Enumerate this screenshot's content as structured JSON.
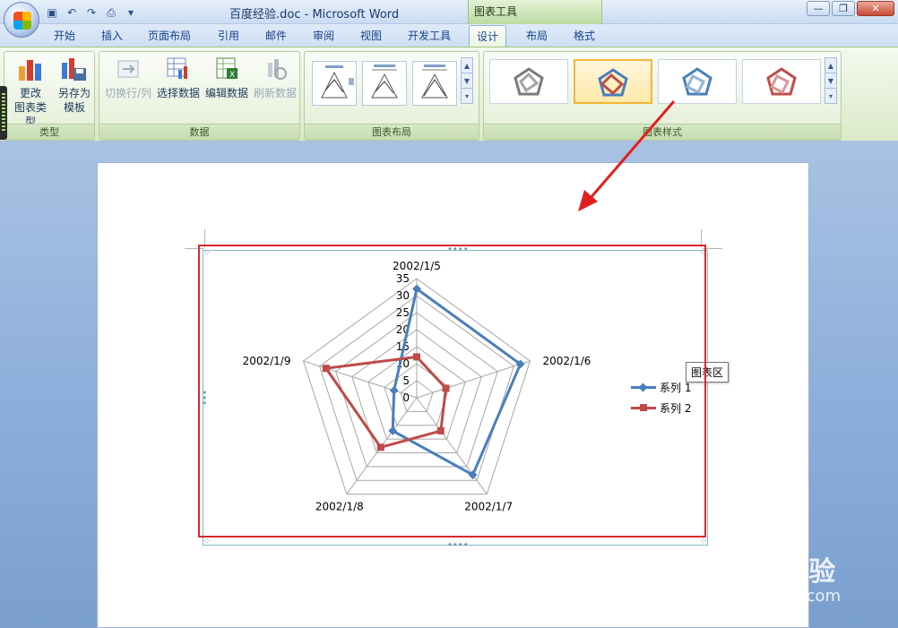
{
  "window": {
    "doc_title": "百度经验.doc - Microsoft Word",
    "context_tab_label": "图表工具"
  },
  "quick_access": [
    "save-icon",
    "undo-icon",
    "redo-icon",
    "print-preview-icon"
  ],
  "tabs": [
    "开始",
    "插入",
    "页面布局",
    "引用",
    "邮件",
    "审阅",
    "视图",
    "开发工具",
    "设计",
    "布局",
    "格式"
  ],
  "active_tab": "设计",
  "ribbon": {
    "groups": {
      "type": {
        "label": "类型",
        "buttons": [
          {
            "label1": "更改",
            "label2": "图表类型"
          },
          {
            "label1": "另存为",
            "label2": "模板"
          }
        ]
      },
      "data": {
        "label": "数据",
        "buttons": [
          {
            "label": "切换行/列",
            "disabled": true
          },
          {
            "label": "选择数据",
            "disabled": false
          },
          {
            "label": "编辑数据",
            "disabled": false
          },
          {
            "label": "刷新数据",
            "disabled": true
          }
        ]
      },
      "layout": {
        "label": "图表布局"
      },
      "styles": {
        "label": "图表样式"
      }
    }
  },
  "chart_tooltip": "图表区",
  "chart_data": {
    "type": "radar",
    "categories": [
      "2002/1/5",
      "2002/1/6",
      "2002/1/7",
      "2002/1/8",
      "2002/1/9"
    ],
    "series": [
      {
        "name": "系列 1",
        "values": [
          32,
          32,
          28,
          12,
          7
        ],
        "color": "#4a7ebb"
      },
      {
        "name": "系列 2",
        "values": [
          12,
          9,
          12,
          18,
          28
        ],
        "color": "#be4b48"
      }
    ],
    "axis_ticks": [
      0,
      5,
      10,
      15,
      20,
      25,
      30,
      35
    ],
    "ylim": [
      0,
      35
    ],
    "legend": "right"
  },
  "watermark": {
    "main": "Baidu经验",
    "sub": "jingyan.baidu.com"
  }
}
